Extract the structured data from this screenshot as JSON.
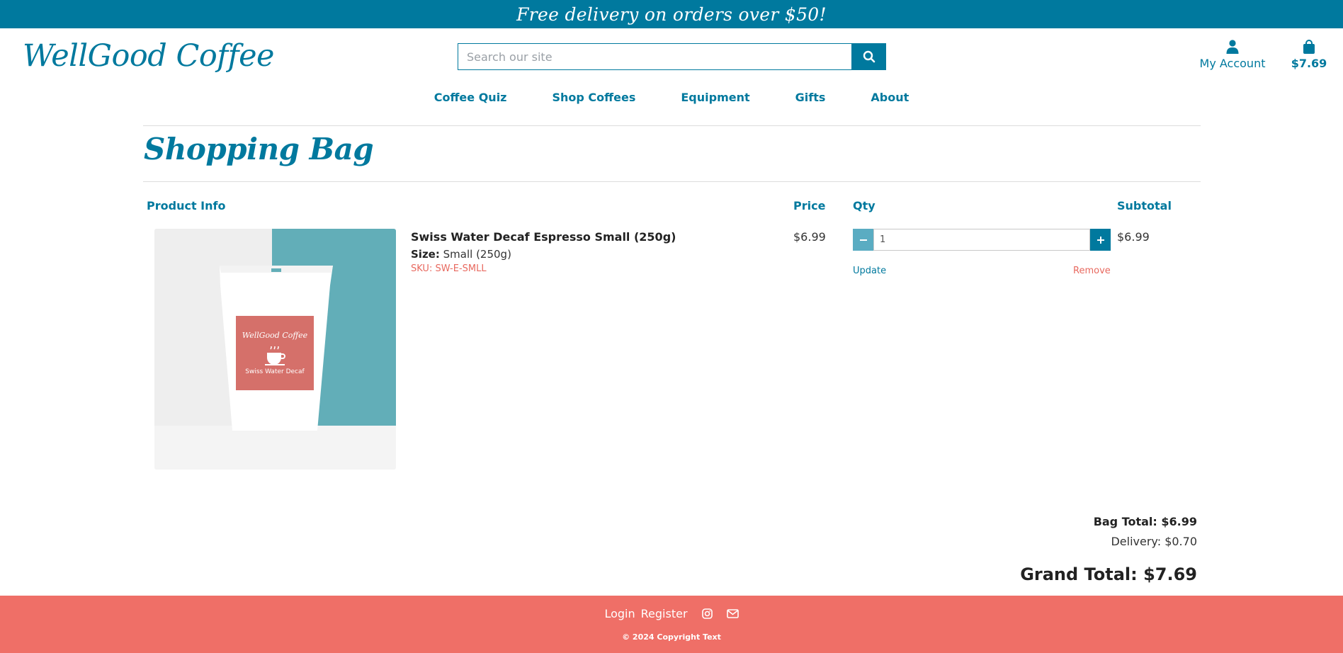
{
  "banner": {
    "text": "Free delivery on orders over $50!"
  },
  "header": {
    "logo": "WellGood Coffee",
    "search_placeholder": "Search our site",
    "account_label": "My Account",
    "bag_total": "$7.69"
  },
  "nav": [
    "Coffee Quiz",
    "Shop Coffees",
    "Equipment",
    "Gifts",
    "About"
  ],
  "page": {
    "title": "Shopping Bag"
  },
  "table": {
    "headers": {
      "product": "Product Info",
      "price": "Price",
      "qty": "Qty",
      "subtotal": "Subtotal"
    },
    "rows": [
      {
        "name": "Swiss Water Decaf Espresso Small (250g)",
        "size_label": "Size:",
        "size_value": "Small (250g)",
        "sku": "SKU: SW-E-SMLL",
        "price": "$6.99",
        "qty": "1",
        "update_label": "Update",
        "remove_label": "Remove",
        "subtotal": "$6.99",
        "image_label_brand": "WellGood Coffee",
        "image_label_product": "Swiss Water Decaf"
      }
    ]
  },
  "totals": {
    "bag_total": "Bag Total: $6.99",
    "delivery": "Delivery: $0.70",
    "grand_total": "Grand Total: $7.69"
  },
  "footer": {
    "login": "Login",
    "register": "Register",
    "copyright": "© 2024 Copyright Text"
  },
  "colors": {
    "brand": "#00799e",
    "accent": "#ef6f67",
    "qty_minus": "#5aacc2"
  }
}
